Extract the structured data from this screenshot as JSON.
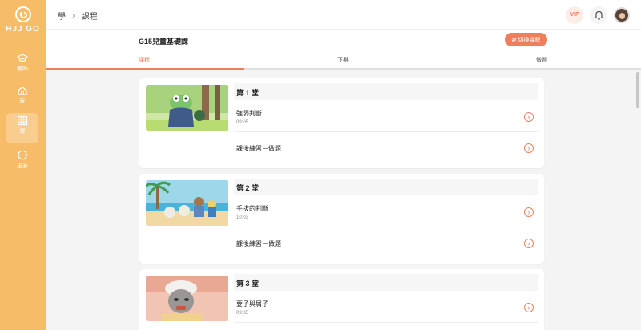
{
  "sidebar": {
    "brand": "HJJ GO",
    "items": [
      {
        "label": "教師",
        "icon": "graduation-cap-icon"
      },
      {
        "label": "玩",
        "icon": "home-icon"
      },
      {
        "label": "學",
        "icon": "grid-icon"
      },
      {
        "label": "更多",
        "icon": "more-icon"
      }
    ]
  },
  "topbar": {
    "breadcrumb": [
      "學",
      "課程"
    ],
    "vip": "VIP"
  },
  "course": {
    "title": "G15兒童基礎課",
    "switch_label": "切換課程"
  },
  "tabs": [
    "課程",
    "下棋",
    "做題"
  ],
  "lessons": [
    {
      "title": "第 1 堂",
      "video": {
        "title": "強弱判斷",
        "time": "09:05"
      },
      "practice": "課後練習－做題"
    },
    {
      "title": "第 2 堂",
      "video": {
        "title": "手拔的判斷",
        "time": "10:03"
      },
      "practice": "課後練習－做題"
    },
    {
      "title": "第 3 堂",
      "video": {
        "title": "要子與屑子",
        "time": "09:35"
      }
    }
  ],
  "colors": {
    "accent": "#ef7f5a",
    "sidebar": "#f6bc67"
  }
}
